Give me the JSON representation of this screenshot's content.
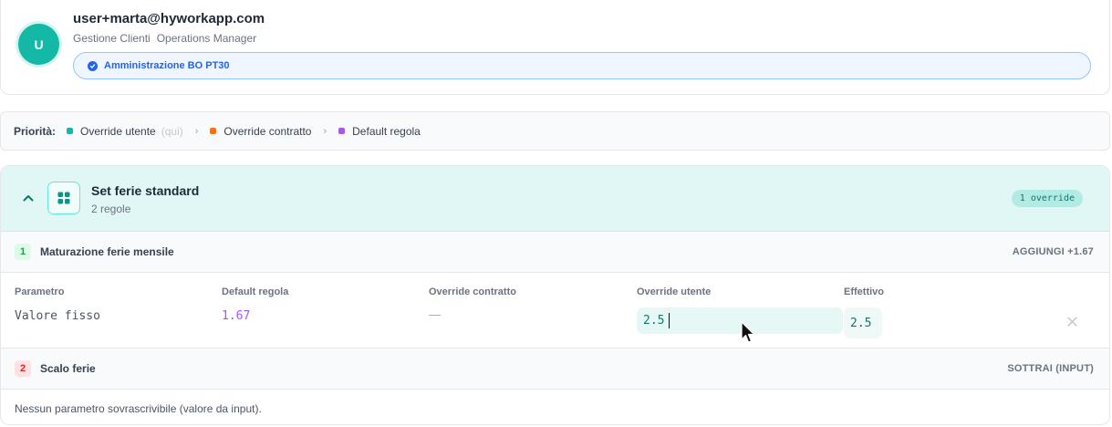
{
  "user": {
    "avatar_initial": "U",
    "email": "user+marta@hyworkapp.com",
    "roles": [
      "Gestione Clienti",
      "Operations Manager"
    ],
    "assignment": "Amministrazione BO PT30"
  },
  "priority": {
    "title": "Priorità:",
    "items": [
      {
        "label": "Override utente",
        "hint": "(qui)",
        "color": "#14b8a6"
      },
      {
        "label": "Override contratto",
        "hint": "",
        "color": "#f97316"
      },
      {
        "label": "Default regola",
        "hint": "",
        "color": "#a855f7"
      }
    ],
    "separator": "›"
  },
  "rule_set": {
    "title": "Set ferie standard",
    "subtitle": "2 regole",
    "badge": "1 override",
    "rules": [
      {
        "number": "1",
        "name": "Maturazione ferie mensile",
        "action": "AGGIUNGI +1.67",
        "num_color": "#16a34a",
        "num_bg": "#dcfce7"
      },
      {
        "number": "2",
        "name": "Scalo ferie",
        "action": "SOTTRAI (INPUT)",
        "num_color": "#dc2626",
        "num_bg": "#fee2e2"
      }
    ],
    "columns": [
      "Parametro",
      "Default regola",
      "Override contratto",
      "Override utente",
      "Effettivo"
    ],
    "param": {
      "name": "Valore fisso",
      "default": "1.67",
      "contract": "—",
      "user_override": "2.5",
      "effective": "2.5"
    },
    "empty_note": "Nessun parametro sovrascrivibile (valore da input)."
  }
}
